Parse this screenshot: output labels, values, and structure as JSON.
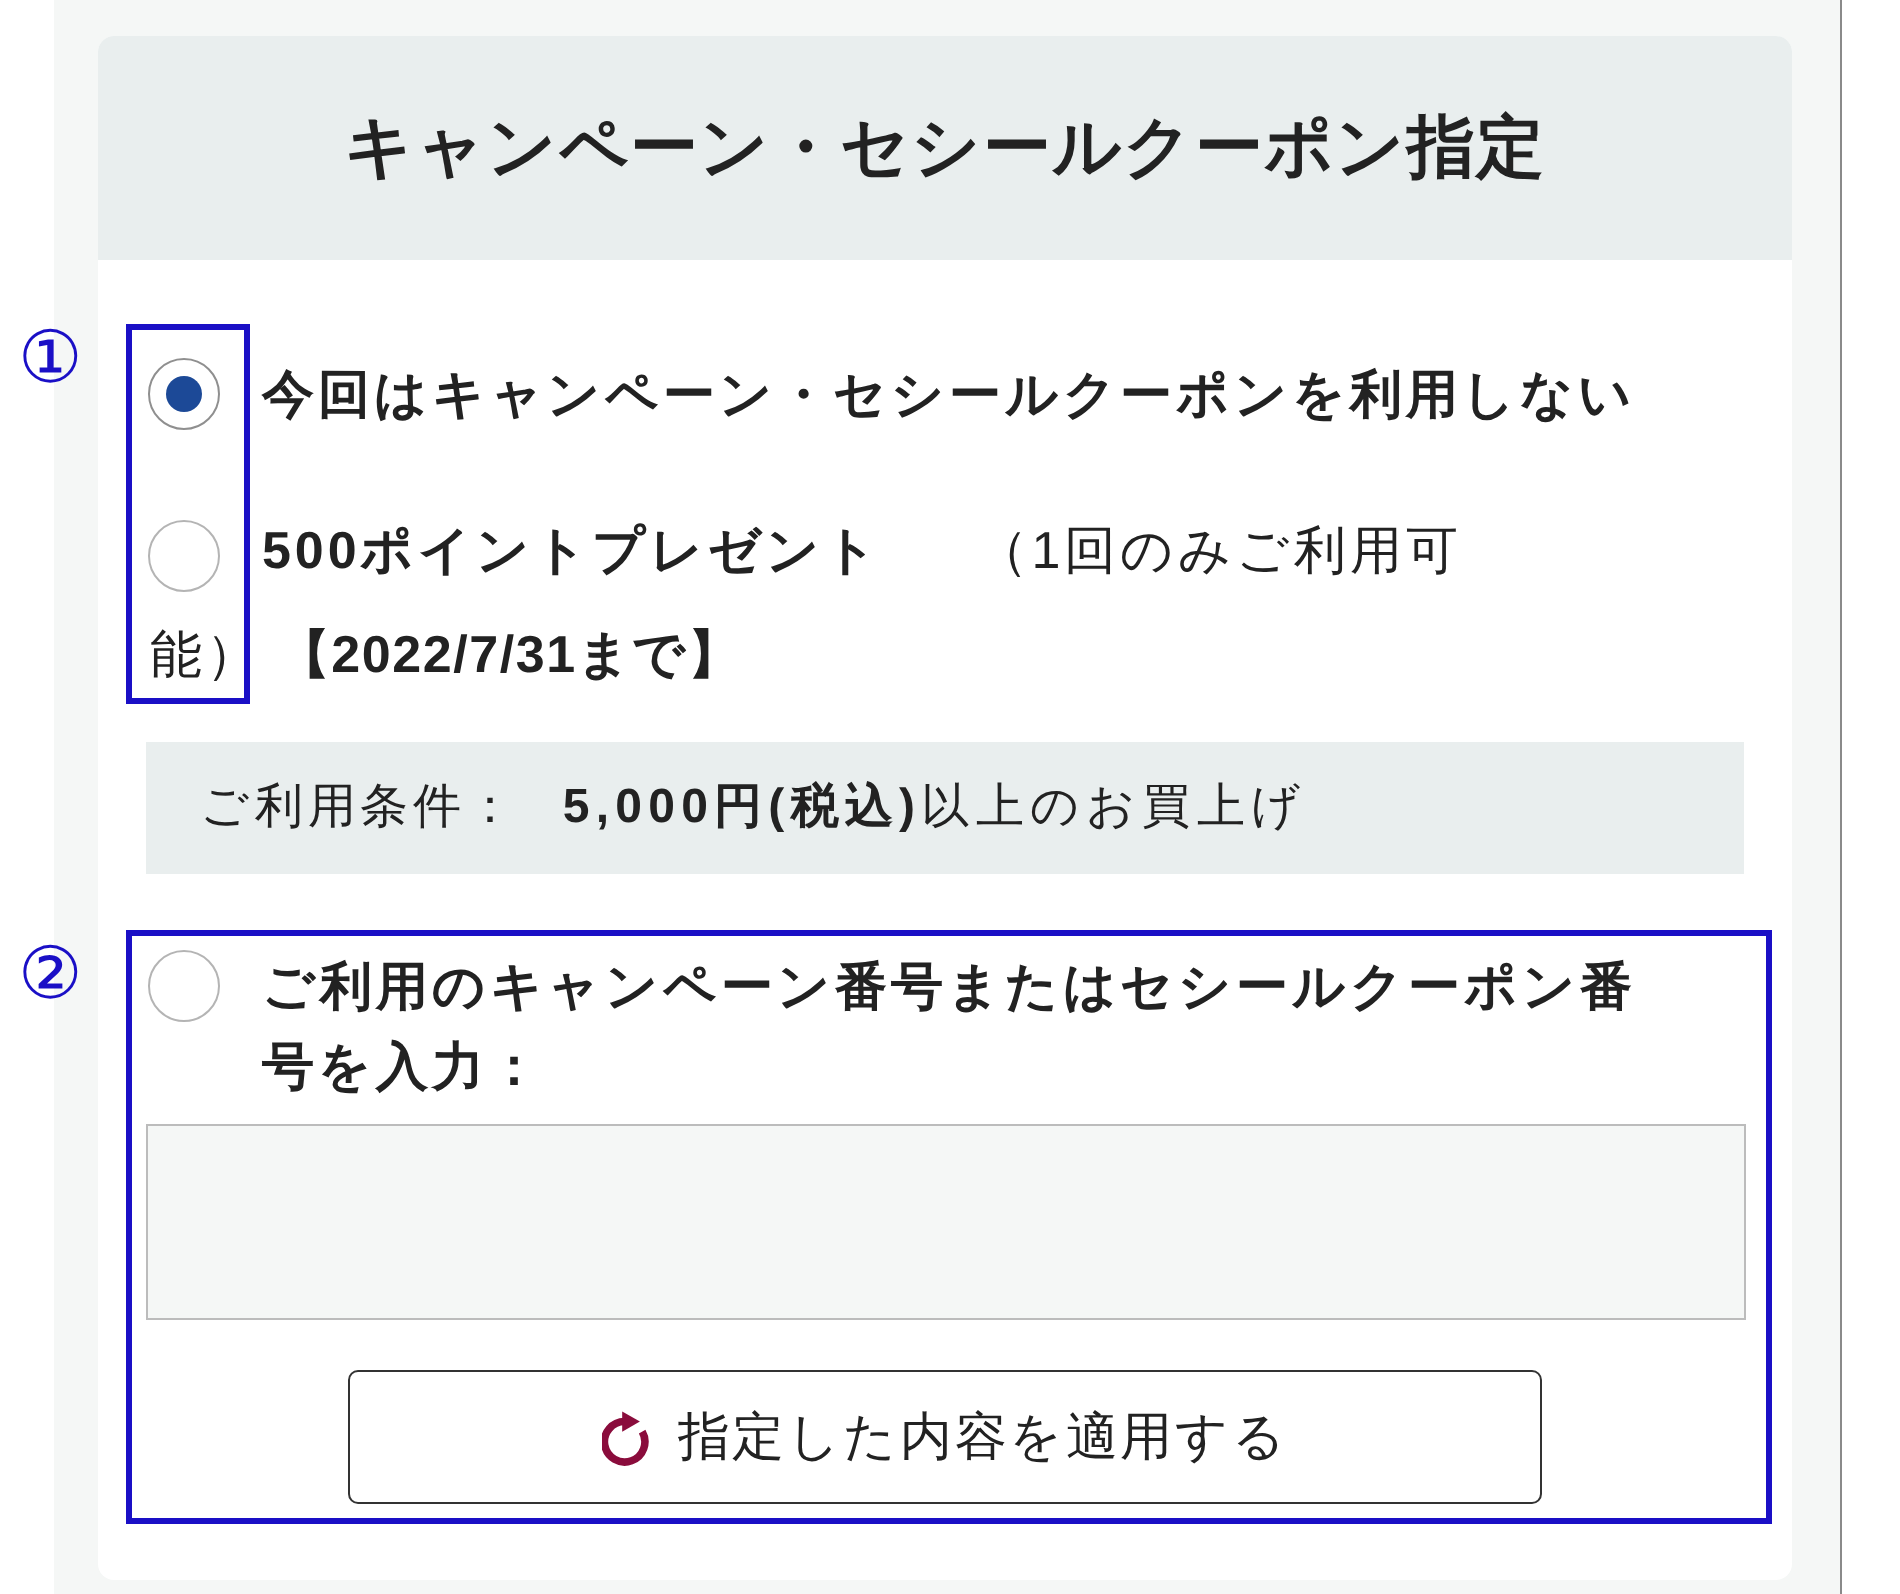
{
  "title": "キャンペーン・セシールクーポン指定",
  "option_group": {
    "annotation": "①",
    "options": [
      {
        "label": "今回はキャンペーン・セシールクーポンを利用しない",
        "selected": true
      },
      {
        "label": "500ポイントプレゼント",
        "note": [
          "（1回のみご利用可",
          "能）"
        ],
        "period": "【2022/7/31まで】",
        "selected": false
      }
    ]
  },
  "condition": {
    "label": "ご利用条件：",
    "value": "**5,000円(税込)**以上のお買上げ"
  },
  "code_entry": {
    "annotation": "②",
    "label": "ご利用のキャンペーン番号またはセシールクーポン番号を入力：",
    "selected": false
  },
  "apply_button": {
    "label": "指定した内容を適用する"
  }
}
